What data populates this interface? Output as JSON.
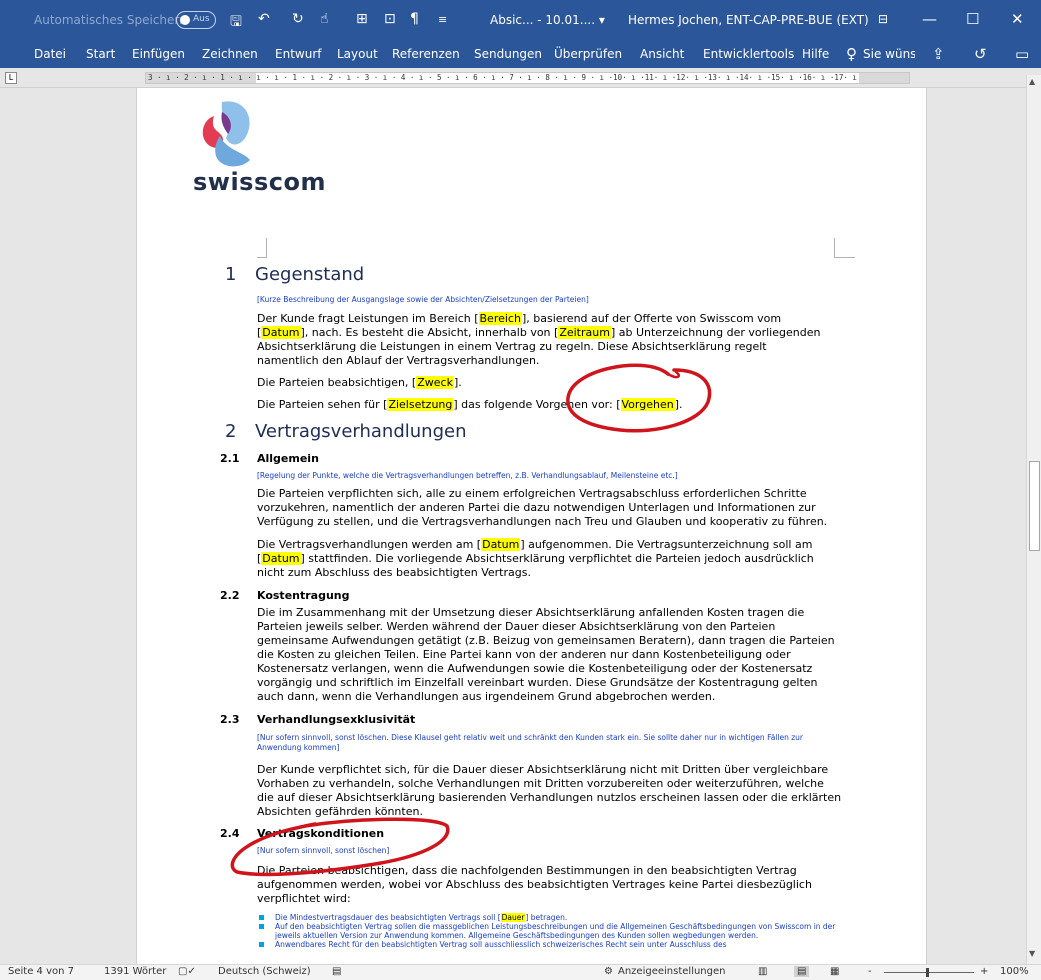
{
  "titlebar": {
    "autosave_label": "Automatisches Speichern",
    "autosave_state": "Aus",
    "doc_title": "Absic... - 10.01.... ▾",
    "user": "Hermes Jochen, ENT-CAP-PRE-BUE (EXT)"
  },
  "ribbon": {
    "tabs": [
      "Datei",
      "Start",
      "Einfügen",
      "Zeichnen",
      "Entwurf",
      "Layout",
      "Referenzen",
      "Sendungen",
      "Überprüfen",
      "Ansicht",
      "Entwicklertools",
      "Hilfe"
    ],
    "tell_me": "Sie wünsc"
  },
  "ruler": {
    "scale": "3 · ı · 2 · ı · 1 · ı · ı · ı · 1 · ı · 2 · ı · 3 · ı · 4 · ı · 5 · ı · 6 · ı · 7 · ı · 8 · ı · 9 · ı ·10· ı ·11· ı ·12· ı ·13· ı ·14· ı ·15· ı ·16· ı ·17· ı"
  },
  "document": {
    "logo_text": "swisscom",
    "s1": {
      "num": "1",
      "title": "Gegenstand",
      "hint": "[Kurze Beschreibung der Ausgangslage sowie der Absichten/Zielsetzungen der Parteien]",
      "p1_a": "Der Kunde fragt Leistungen im Bereich [",
      "p1_bereich": "Bereich",
      "p1_b": "], basierend auf der Offerte von Swisscom vom [",
      "p1_datum": "Datum",
      "p1_c": "], nach. Es besteht die Absicht, innerhalb von [",
      "p1_zeitraum": "Zeitraum",
      "p1_d": "] ab Unterzeichnung der vorliegenden Absichtserklärung die Leistungen in einem Vertrag zu regeln. Diese Absichtserklärung regelt namentlich den Ablauf der Vertragsverhandlungen.",
      "p2_a": "Die Parteien beabsichtigen, [",
      "p2_zweck": "Zweck",
      "p2_b": "].",
      "p3_a": "Die Parteien sehen für [",
      "p3_ziel": "Zielsetzung",
      "p3_b": "] das folgende Vorgehen vor: [",
      "p3_vorgehen": "Vorgehen",
      "p3_c": "]."
    },
    "s2": {
      "num": "2",
      "title": "Vertragsverhandlungen",
      "s21": {
        "num": "2.1",
        "title": "Allgemein",
        "hint": "[Regelung der Punkte, welche die Vertragsverhandlungen betreffen, z.B. Verhandlungsablauf, Meilensteine etc.]",
        "p1": "Die Parteien verpflichten sich, alle zu einem erfolgreichen Vertragsabschluss erforderlichen Schritte vorzukehren, namentlich der anderen Partei die dazu notwendigen Unterlagen und Informationen zur Verfügung zu stellen, und die Vertragsverhandlungen nach Treu und Glauben und kooperativ zu führen.",
        "p2_a": "Die Vertragsverhandlungen werden am [",
        "p2_datum1": "Datum",
        "p2_b": "] aufgenommen. Die Vertragsunterzeichnung soll am [",
        "p2_datum2": "Datum",
        "p2_c": "] stattfinden. Die vorliegende Absichtserklärung verpflichtet die Parteien jedoch ausdrücklich nicht zum Abschluss des beabsichtigten Vertrags."
      },
      "s22": {
        "num": "2.2",
        "title": "Kostentragung",
        "p1": "Die im Zusammenhang mit der Umsetzung dieser Absichtserklärung anfallenden Kosten tragen die Parteien jeweils selber. Werden während der Dauer dieser Absichtserklärung von den Parteien gemeinsame Aufwendungen getätigt (z.B. Beizug von gemeinsamen Beratern), dann tragen die Parteien die Kosten zu gleichen Teilen. Eine Partei kann von der anderen nur dann Kostenbeteiligung oder Kostenersatz verlangen, wenn die Aufwendungen sowie die Kostenbeteiligung oder der Kostenersatz vorgängig und schriftlich im Einzelfall vereinbart wurden. Diese Grundsätze der Kostentragung gelten auch dann, wenn die Verhandlungen aus irgendeinem Grund abgebrochen werden."
      },
      "s23": {
        "num": "2.3",
        "title": "Verhandlungsexklusivität",
        "hint": "[Nur sofern sinnvoll, sonst löschen. Diese Klausel geht relativ weit und schränkt den Kunden stark ein. Sie sollte daher nur in wichtigen Fällen zur Anwendung kommen]",
        "p1": "Der Kunde verpflichtet sich, für die Dauer dieser Absichtserklärung nicht mit Dritten über vergleichbare Vorhaben zu verhandeln, solche Verhandlungen mit Dritten vorzubereiten oder weiterzuführen, welche die auf dieser Absichtserklärung basierenden Verhandlungen nutzlos erscheinen lassen oder die erklärten Absichten gefährden könnten."
      },
      "s24": {
        "num": "2.4",
        "title": "Vertragskonditionen",
        "hint": "[Nur sofern sinnvoll, sonst löschen]",
        "p1": "Die Parteien beabsichtigen, dass die nachfolgenden Bestimmungen in den beabsichtigten Vertrag aufgenommen werden, wobei vor Abschluss des beabsichtigten Vertrages keine Partei diesbezüglich verpflichtet wird:",
        "b1_a": "Die Mindestvertragsdauer des beabsichtigten Vertrags soll [",
        "b1_dauer": "Dauer",
        "b1_b": "] betragen.",
        "b2": "Auf den beabsichtigten Vertrag sollen die massgeblichen Leistungsbeschreibungen und die Allgemeinen Geschäftsbedingungen von Swisscom in der jeweils aktuellen Version zur Anwendung kommen. Allgemeine Geschäftsbedingungen des Kunden sollen wegbedungen werden.",
        "b3": "Anwendbares Recht für den beabsichtigten Vertrag soll ausschliesslich schweizerisches Recht sein unter Ausschluss des"
      }
    }
  },
  "statusbar": {
    "page": "Seite 4 von 7",
    "words": "1391 Wörter",
    "language": "Deutsch (Schweiz)",
    "display_settings": "Anzeigeeinstellungen",
    "zoom": "100%",
    "zoom_minus": "-",
    "zoom_plus": "+"
  },
  "colors": {
    "word_blue": "#2b579a",
    "heading": "#1f2d55",
    "hint": "#1a3fc4",
    "highlight": "#ffff00",
    "annotation": "#d0141c"
  }
}
